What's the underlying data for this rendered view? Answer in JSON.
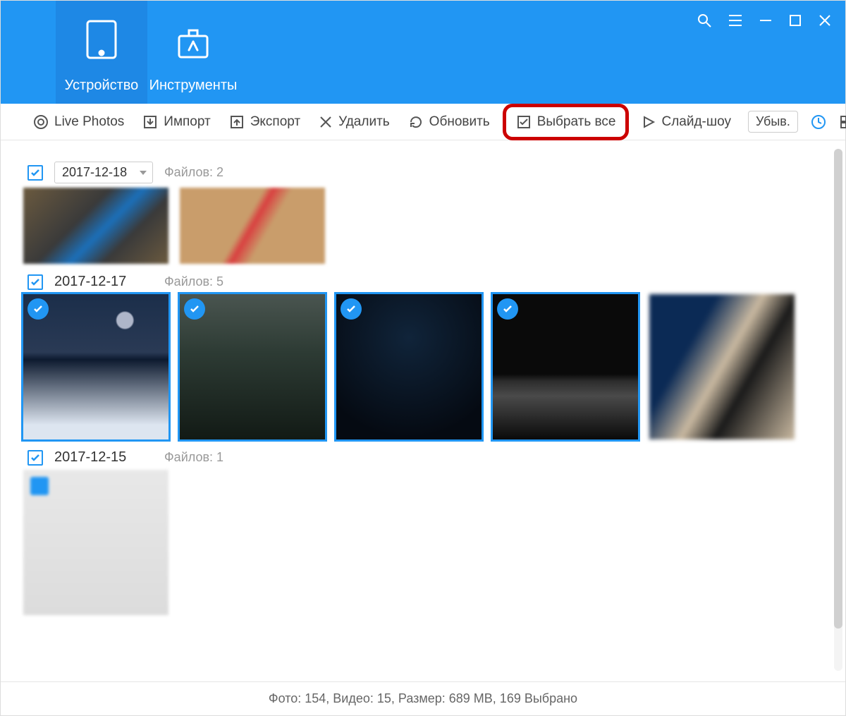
{
  "header": {
    "tabs": [
      {
        "label": "Устройство",
        "active": true
      },
      {
        "label": "Инструменты",
        "active": false
      }
    ]
  },
  "toolbar": {
    "live_photos": "Live Photos",
    "import": "Импорт",
    "export": "Экспорт",
    "delete": "Удалить",
    "refresh": "Обновить",
    "select_all": "Выбрать все",
    "slideshow": "Слайд-шоу",
    "sort": "Убыв."
  },
  "groups": [
    {
      "date": "2017-12-18",
      "dropdown": true,
      "count_label": "Файлов: 2",
      "thumbs": [
        {
          "cls": "t-a1",
          "selected": false,
          "big": false
        },
        {
          "cls": "t-a2",
          "selected": false,
          "big": false
        }
      ]
    },
    {
      "date": "2017-12-17",
      "dropdown": false,
      "count_label": "Файлов: 5",
      "thumbs": [
        {
          "cls": "t-b1",
          "selected": true,
          "big": true
        },
        {
          "cls": "t-b2",
          "selected": true,
          "big": true
        },
        {
          "cls": "t-b3",
          "selected": true,
          "big": true
        },
        {
          "cls": "t-b4",
          "selected": true,
          "big": true
        },
        {
          "cls": "t-b5",
          "selected": false,
          "big": true
        }
      ]
    },
    {
      "date": "2017-12-15",
      "dropdown": false,
      "count_label": "Файлов: 1",
      "thumbs": [
        {
          "cls": "t-c1",
          "selected": false,
          "big": true
        }
      ]
    }
  ],
  "status": "Фото: 154, Видео: 15, Размер: 689 MB, 169 Выбрано"
}
